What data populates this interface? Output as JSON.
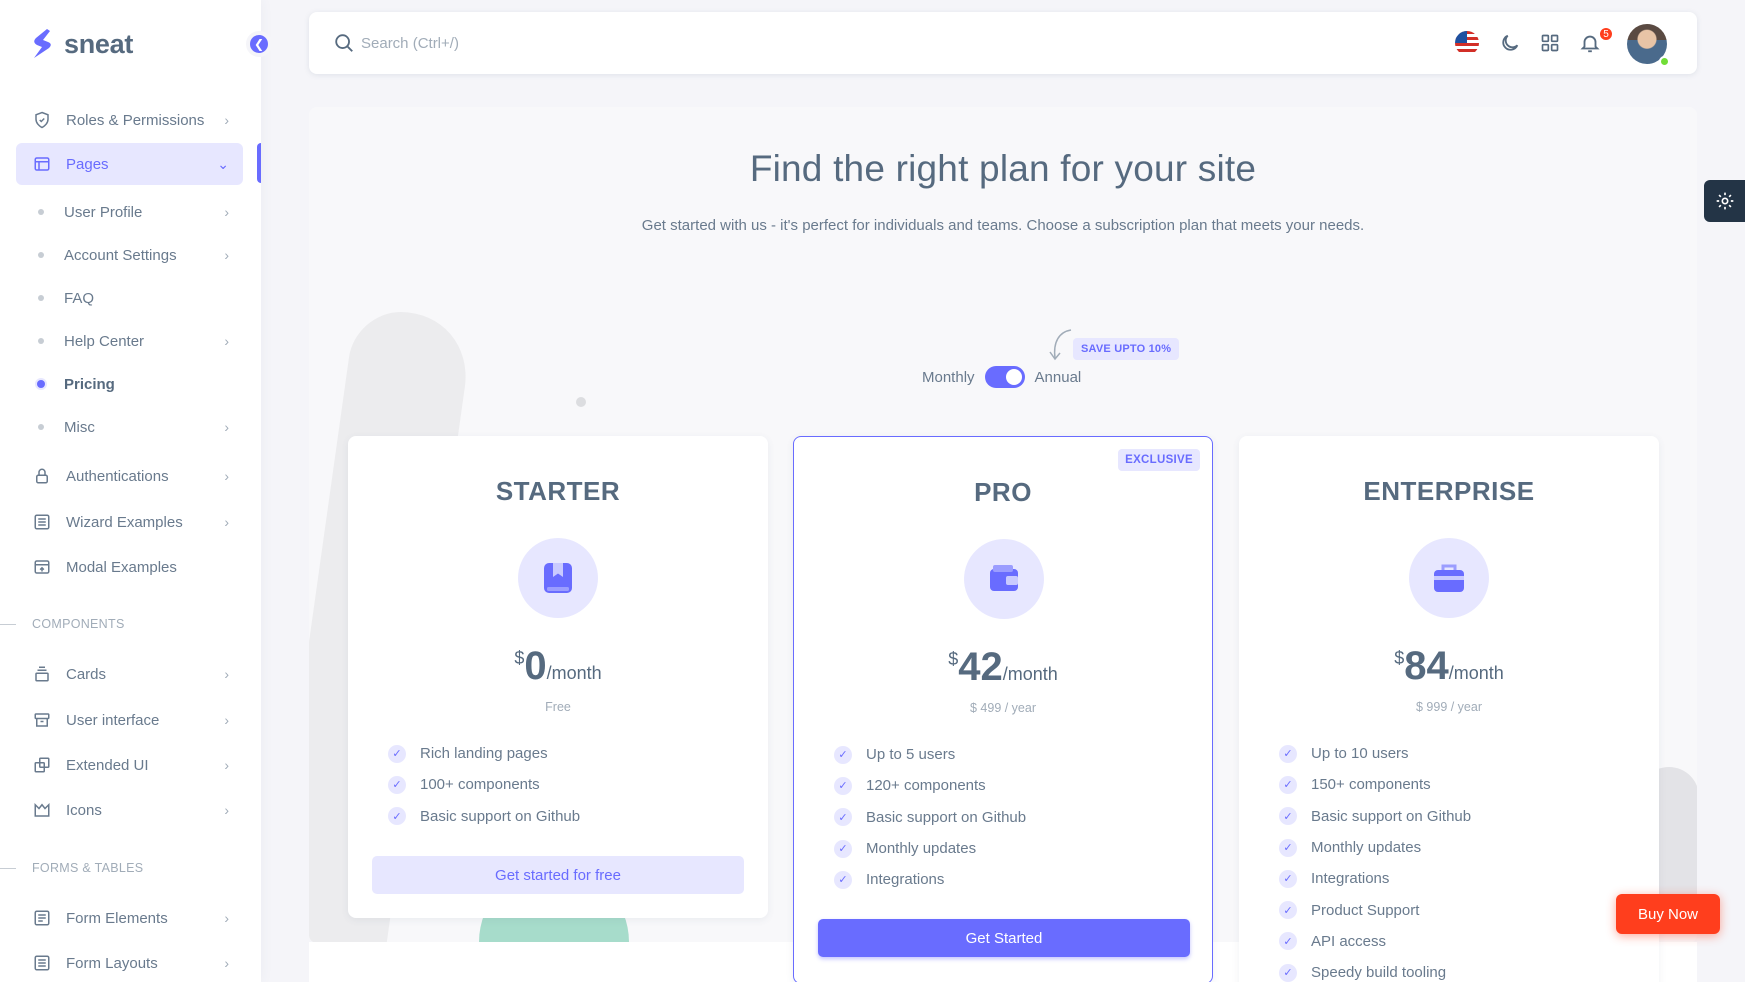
{
  "brand": {
    "name": "sneat",
    "accent_color": "#696cff"
  },
  "sidebar": {
    "items": [
      {
        "label": "Roles & Permissions",
        "icon": "shield-icon",
        "has_submenu": true
      },
      {
        "label": "Pages",
        "icon": "page-icon",
        "has_submenu": true,
        "expanded": true,
        "active": true
      },
      {
        "label": "Authentications",
        "icon": "lock-icon",
        "has_submenu": true
      },
      {
        "label": "Wizard Examples",
        "icon": "list-icon",
        "has_submenu": true
      },
      {
        "label": "Modal Examples",
        "icon": "window-icon",
        "has_submenu": false
      },
      {
        "label": "Cards",
        "icon": "stack-icon",
        "has_submenu": true
      },
      {
        "label": "User interface",
        "icon": "box-icon",
        "has_submenu": true
      },
      {
        "label": "Extended UI",
        "icon": "copy-icon",
        "has_submenu": true
      },
      {
        "label": "Icons",
        "icon": "crown-icon",
        "has_submenu": true
      },
      {
        "label": "Form Elements",
        "icon": "form-icon",
        "has_submenu": true
      },
      {
        "label": "Form Layouts",
        "icon": "form-layout-icon",
        "has_submenu": true
      }
    ],
    "pages_submenu": [
      {
        "label": "User Profile",
        "has_submenu": true
      },
      {
        "label": "Account Settings",
        "has_submenu": true
      },
      {
        "label": "FAQ",
        "has_submenu": false
      },
      {
        "label": "Help Center",
        "has_submenu": true
      },
      {
        "label": "Pricing",
        "has_submenu": false,
        "current": true
      },
      {
        "label": "Misc",
        "has_submenu": true
      }
    ],
    "sections": [
      "COMPONENTS",
      "FORMS & TABLES"
    ]
  },
  "navbar": {
    "search_placeholder": "Search (Ctrl+/)",
    "icons": [
      "us-flag-icon",
      "moon-icon",
      "grid-icon",
      "bell-icon"
    ],
    "notification_count": "5"
  },
  "pricing": {
    "title": "Find the right plan for your site",
    "subtitle": "Get started with us - it's perfect for individuals and teams. Choose a subscription plan that meets your needs.",
    "toggle": {
      "monthly": "Monthly",
      "annual": "Annual",
      "annual_selected": true
    },
    "save_badge": "SAVE UPTO 10%",
    "plans": [
      {
        "name": "STARTER",
        "icon": "bookmark-box-icon",
        "currency": "$",
        "amount": "0",
        "period": "/month",
        "sub": "Free",
        "features": [
          "Rich landing pages",
          "100+ components",
          "Basic support on Github"
        ],
        "button": "Get started for free"
      },
      {
        "name": "PRO",
        "icon": "wallet-icon",
        "badge": "EXCLUSIVE",
        "currency": "$",
        "amount": "42",
        "period": "/month",
        "sub": "$ 499 / year",
        "features": [
          "Up to 5 users",
          "120+ components",
          "Basic support on Github",
          "Monthly updates",
          "Integrations"
        ],
        "button": "Get Started"
      },
      {
        "name": "ENTERPRISE",
        "icon": "briefcase-icon",
        "currency": "$",
        "amount": "84",
        "period": "/month",
        "sub": "$ 999 / year",
        "features": [
          "Up to 10 users",
          "150+ components",
          "Basic support on Github",
          "Monthly updates",
          "Integrations",
          "Product Support",
          "API access",
          "Speedy build tooling"
        ],
        "button": ""
      }
    ]
  },
  "buy_now": "Buy Now",
  "colors": {
    "primary": "#696cff",
    "primary_light": "#e7e7ff",
    "danger": "#ff3e1d",
    "text": "#566a7f",
    "success": "#71dd37"
  }
}
